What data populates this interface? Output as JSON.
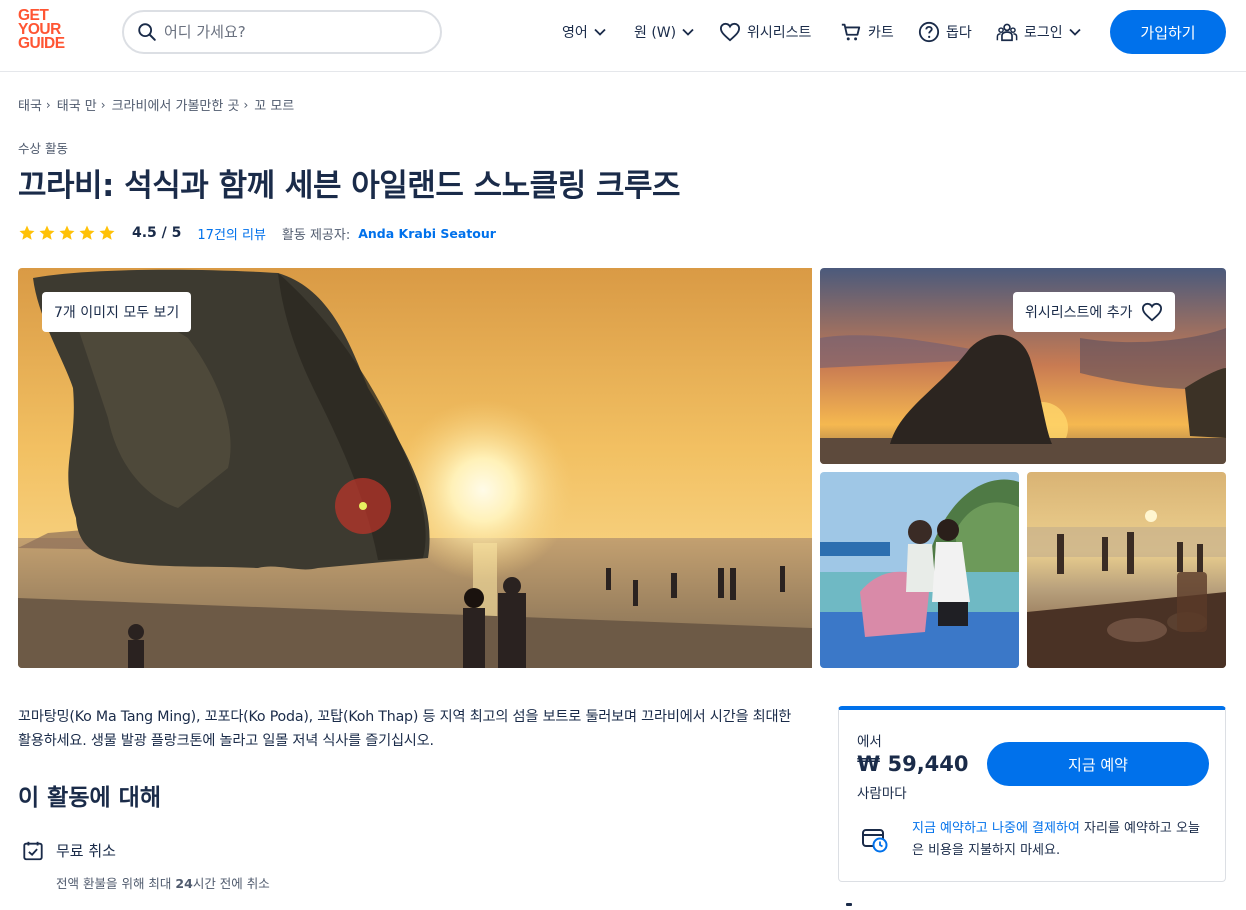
{
  "header": {
    "logo_lines": [
      "GET",
      "YOUR",
      "GUIDE"
    ],
    "search_placeholder": "어디 가세요?",
    "language": "영어",
    "currency": "원 (W)",
    "wishlist": "위시리스트",
    "cart": "카트",
    "help": "돕다",
    "login": "로그인",
    "signup": "가입하기"
  },
  "breadcrumb": [
    "태국",
    "태국 만",
    "크라비에서 가볼만한 곳",
    "꼬 모르"
  ],
  "activity": {
    "category": "수상 활동",
    "title": "끄라비: 석식과 함께 세븐 아일랜드 스노클링 크루즈",
    "rating": "4.5 / 5",
    "rating_value": 4.5,
    "stars_shown": 5,
    "reviews": "17건의 리뷰",
    "provider_label": "활동 제공자:",
    "provider": "Anda Krabi Seatour"
  },
  "gallery": {
    "view_all": "7개 이미지 모두 보기",
    "add_wishlist": "위시리스트에 추가"
  },
  "description": "꼬마탕밍(Ko Ma Tang Ming), 꼬포다(Ko Poda), 꼬탑(Koh Thap) 등 지역 최고의 섬을 보트로 둘러보며 끄라비에서 시간을 최대한 활용하세요. 생물 발광 플랑크톤에 놀라고 일몰 저녁 식사를 즐기십시오.",
  "about": {
    "heading": "이 활동에 대해",
    "feature_title": "무료 취소",
    "feature_sub_before": "전액 환불을 위해 최대 ",
    "feature_sub_bold": "24",
    "feature_sub_after": "시간 전에 취소"
  },
  "booking": {
    "from": "에서",
    "price": "₩ 59,440",
    "per": "사람마다",
    "book_now": "지금 예약",
    "later_link": "지금 예약하고 나중에 결제하여",
    "later_text": " 자리를 예약하고 오늘은 비용을 지불하지 마세요."
  },
  "colors": {
    "brand_orange": "#ff5533",
    "primary_blue": "#0071eb",
    "text_dark": "#1a2b49",
    "star_yellow": "#ffc107"
  },
  "icons": [
    "search-icon",
    "chevron-down-icon",
    "heart-icon",
    "cart-icon",
    "help-icon",
    "user-group-icon",
    "star-icon",
    "calendar-check-icon",
    "reserve-later-icon"
  ]
}
